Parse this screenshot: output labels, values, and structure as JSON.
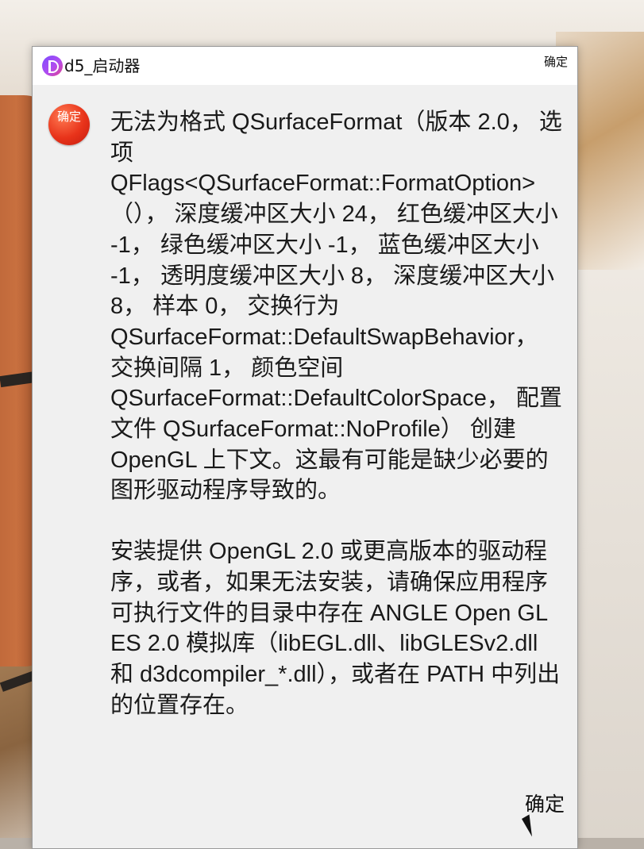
{
  "window": {
    "title": "d5_启动器",
    "title_button_label": "确定",
    "app_icon": "d5-launcher-icon"
  },
  "dialog": {
    "icon_label": "确定",
    "icon_color": "#e8331a",
    "message_paragraph_1": "无法为格式 QSurfaceFormat（版本 2.0， 选项 QFlags<QSurfaceFormat::FormatOption>（）， 深度缓冲区大小 24， 红色缓冲区大小 -1， 绿色缓冲区大小 -1， 蓝色缓冲区大小 -1， 透明度缓冲区大小 8， 深度缓冲区大小 8， 样本 0， 交换行为 QSurfaceFormat::DefaultSwapBehavior， 交换间隔 1， 颜色空间 QSurfaceFormat::DefaultColorSpace， 配置文件 QSurfaceFormat::NoProfile） 创建 OpenGL 上下文。这最有可能是缺少必要的图形驱动程序导致的。",
    "message_paragraph_2": "安装提供 OpenGL 2.0 或更高版本的驱动程序，或者，如果无法安装，请确保应用程序可执行文件的目录中存在 ANGLE Open GL ES 2.0 模拟库（libEGL.dll、libGLESv2.dll 和 d3dcompiler_*.dll），或者在 PATH 中列出的位置存在。",
    "ok_button_label": "确定"
  }
}
